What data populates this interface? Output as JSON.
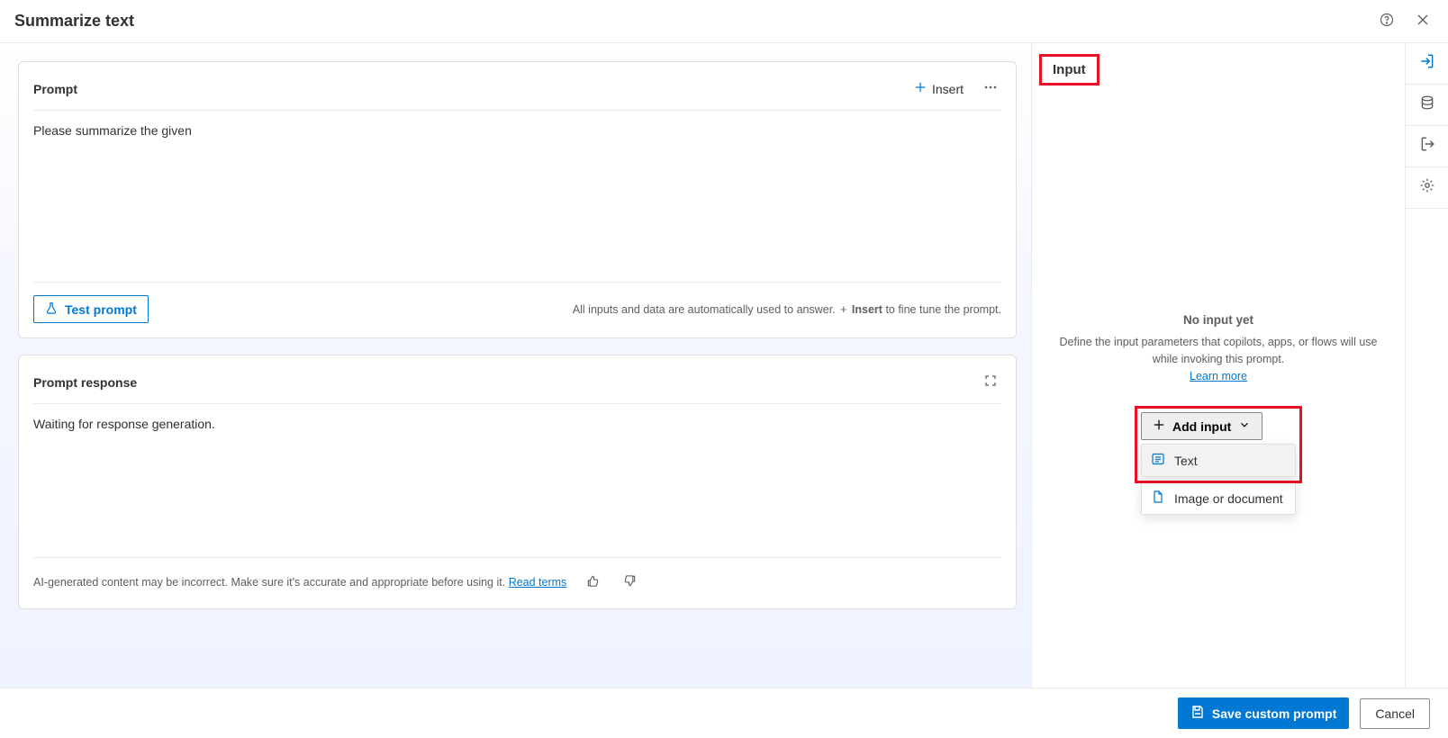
{
  "header": {
    "title": "Summarize text"
  },
  "prompt_card": {
    "title": "Prompt",
    "insert_label": "Insert",
    "body": "Please summarize the given",
    "test_label": "Test prompt",
    "hint_pre": "All inputs and data are automatically used to answer. ",
    "hint_plus": "+",
    "hint_bold": "Insert",
    "hint_post": " to fine tune the prompt."
  },
  "response_card": {
    "title": "Prompt response",
    "body": "Waiting for response generation.",
    "disclaimer": "AI-generated content may be incorrect. Make sure it's accurate and appropriate before using it. ",
    "read_terms": "Read terms"
  },
  "input_panel": {
    "tab_label": "Input",
    "empty_title": "No input yet",
    "empty_desc": "Define the input parameters that copilots, apps, or flows will use while invoking this prompt.",
    "learn_more": "Learn more",
    "add_label": "Add input",
    "options": {
      "text": "Text",
      "image": "Image or document"
    }
  },
  "footer": {
    "save": "Save custom prompt",
    "cancel": "Cancel"
  }
}
